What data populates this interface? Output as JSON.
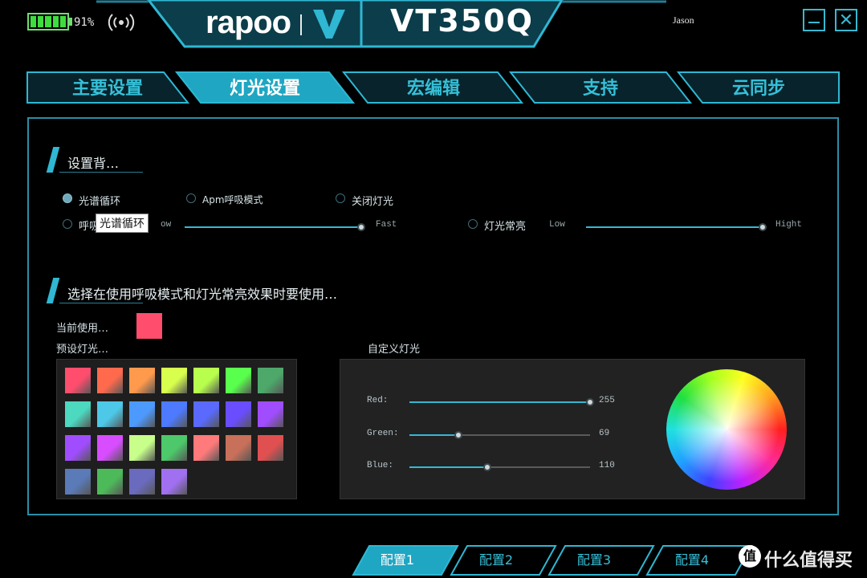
{
  "header": {
    "battery_percent_text": "91%",
    "battery_level": 0.91,
    "brand": "rapoo",
    "model": "VT350Q",
    "username": "Jason",
    "minimize_icon": "minimize-icon",
    "close_label": "✕"
  },
  "tabs": [
    {
      "label": "主要设置",
      "active": false
    },
    {
      "label": "灯光设置",
      "active": true
    },
    {
      "label": "宏编辑",
      "active": false
    },
    {
      "label": "支持",
      "active": false
    },
    {
      "label": "云同步",
      "active": false
    }
  ],
  "section1": {
    "title": "设置背…",
    "options": {
      "spectrum": {
        "label": "光谱循环",
        "selected": true
      },
      "apm_breath": {
        "label": "Apm呼吸模式",
        "selected": false
      },
      "off": {
        "label": "关闭灯光",
        "selected": false
      },
      "breath": {
        "label": "呼吸",
        "selected": false
      },
      "steady": {
        "label": "灯光常亮",
        "selected": false
      }
    },
    "breath_slider": {
      "low_label": "ow",
      "high_label": "Fast",
      "level": 1.0
    },
    "steady_slider": {
      "low_label": "Low",
      "high_label": "Hight",
      "level": 1.0
    },
    "tooltip": "光谱循环"
  },
  "section2": {
    "title": "选择在使用呼吸模式和灯光常亮效果时要使用…",
    "current_label": "当前使用…",
    "current_color": "#ff4d6d",
    "preset_label": "预设灯光…",
    "custom_label": "自定义灯光",
    "presets": [
      "#ff4d6d",
      "#ff6a4d",
      "#ff9a4d",
      "#d8ff4d",
      "#b8ff4d",
      "#59ff4d",
      "#4da86a",
      "#4dd8c0",
      "#4dc8e8",
      "#4d9aff",
      "#4d7aff",
      "#5a6aff",
      "#6a4dff",
      "#a04dff",
      "#a04dff",
      "#d84dff",
      "#c8ff8a",
      "#4dc86a",
      "#ff7a7a",
      "#c8705a",
      "#e05050",
      "#5a7ab8",
      "#4dba5a",
      "#6a6abe",
      "#a070f0"
    ],
    "rgb": {
      "red": {
        "label": "Red:",
        "value": "255",
        "level": 1.0
      },
      "green": {
        "label": "Green:",
        "value": "69",
        "level": 0.27
      },
      "blue": {
        "label": "Blue:",
        "value": "110",
        "level": 0.43
      }
    }
  },
  "configs": [
    {
      "label": "配置1",
      "active": true
    },
    {
      "label": "配置2",
      "active": false
    },
    {
      "label": "配置3",
      "active": false
    },
    {
      "label": "配置4",
      "active": false
    }
  ],
  "watermark": {
    "text": "什么值得买",
    "icon": "值"
  },
  "colors": {
    "accent": "#2fb7d3",
    "panel_border": "#2a8ea6"
  }
}
